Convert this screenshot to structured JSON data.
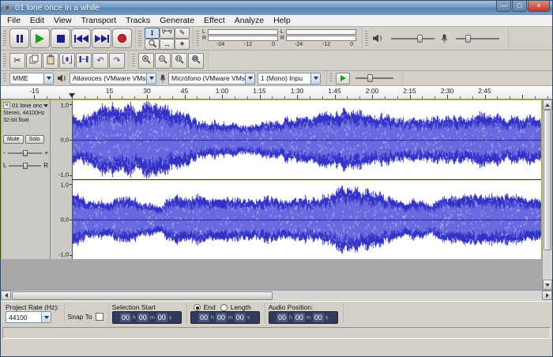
{
  "window": {
    "title": "01 lone once in a while"
  },
  "window_icons": {
    "minimize": "—",
    "maximize": "□",
    "close": "×"
  },
  "menu": {
    "items": [
      "File",
      "Edit",
      "View",
      "Transport",
      "Tracks",
      "Generate",
      "Effect",
      "Analyze",
      "Help"
    ]
  },
  "icons": {
    "selection_tool": "I",
    "draw_tool": "✎",
    "timeshift_tool": "↔",
    "multi_tool": "∗",
    "cut": "✂",
    "undo": "↶",
    "redo": "↷",
    "track_close": "×",
    "gain_minus": "-",
    "gain_plus": "+",
    "pan_left": "L",
    "pan_right": "R"
  },
  "meters": {
    "left_label": "L",
    "right_label": "R",
    "scale": [
      "-24",
      "-12",
      "0"
    ]
  },
  "device_toolbar": {
    "host": "MME",
    "output_device": "Altavoces (VMware VMs",
    "input_device": "Micrófono (VMware VMs",
    "input_channels": "1 (Mono) Inpu"
  },
  "ruler": {
    "labels": [
      {
        "t": -15,
        "label": "-15"
      },
      {
        "t": 15,
        "label": "15"
      },
      {
        "t": 30,
        "label": "30"
      },
      {
        "t": 45,
        "label": "45"
      },
      {
        "t": 60,
        "label": "1:00"
      },
      {
        "t": 75,
        "label": "1:15"
      },
      {
        "t": 90,
        "label": "1:30"
      },
      {
        "t": 105,
        "label": "1:45"
      },
      {
        "t": 120,
        "label": "2:00"
      },
      {
        "t": 135,
        "label": "2:15"
      },
      {
        "t": 150,
        "label": "2:30"
      },
      {
        "t": 165,
        "label": "2:45"
      }
    ]
  },
  "track": {
    "name": "01 lone onc",
    "format_line1": "Stereo, 44100Hz",
    "format_line2": "32-bit float",
    "mute_label": "Mute",
    "solo_label": "Solo",
    "vruler": {
      "top": "1,0",
      "mid": "0,0",
      "bottom": "-1,0"
    }
  },
  "waveform": {
    "peak_color": "#3232c8",
    "rms_color": "#6a6ae0",
    "center_color": "#202090",
    "background": "#ffffff",
    "seeds": [
      11,
      29
    ]
  },
  "selection_toolbar": {
    "project_rate_label": "Project Rate (Hz):",
    "project_rate_value": "44100",
    "snap_label": "Snap To",
    "selection_start_label": "Selection Start",
    "end_label": "End",
    "length_label": "Length",
    "audio_position_label": "Audio Position:",
    "time": {
      "h": "00",
      "h_unit": "h",
      "m": "00",
      "m_unit": "m",
      "s": "00",
      "s_unit": "s"
    }
  }
}
